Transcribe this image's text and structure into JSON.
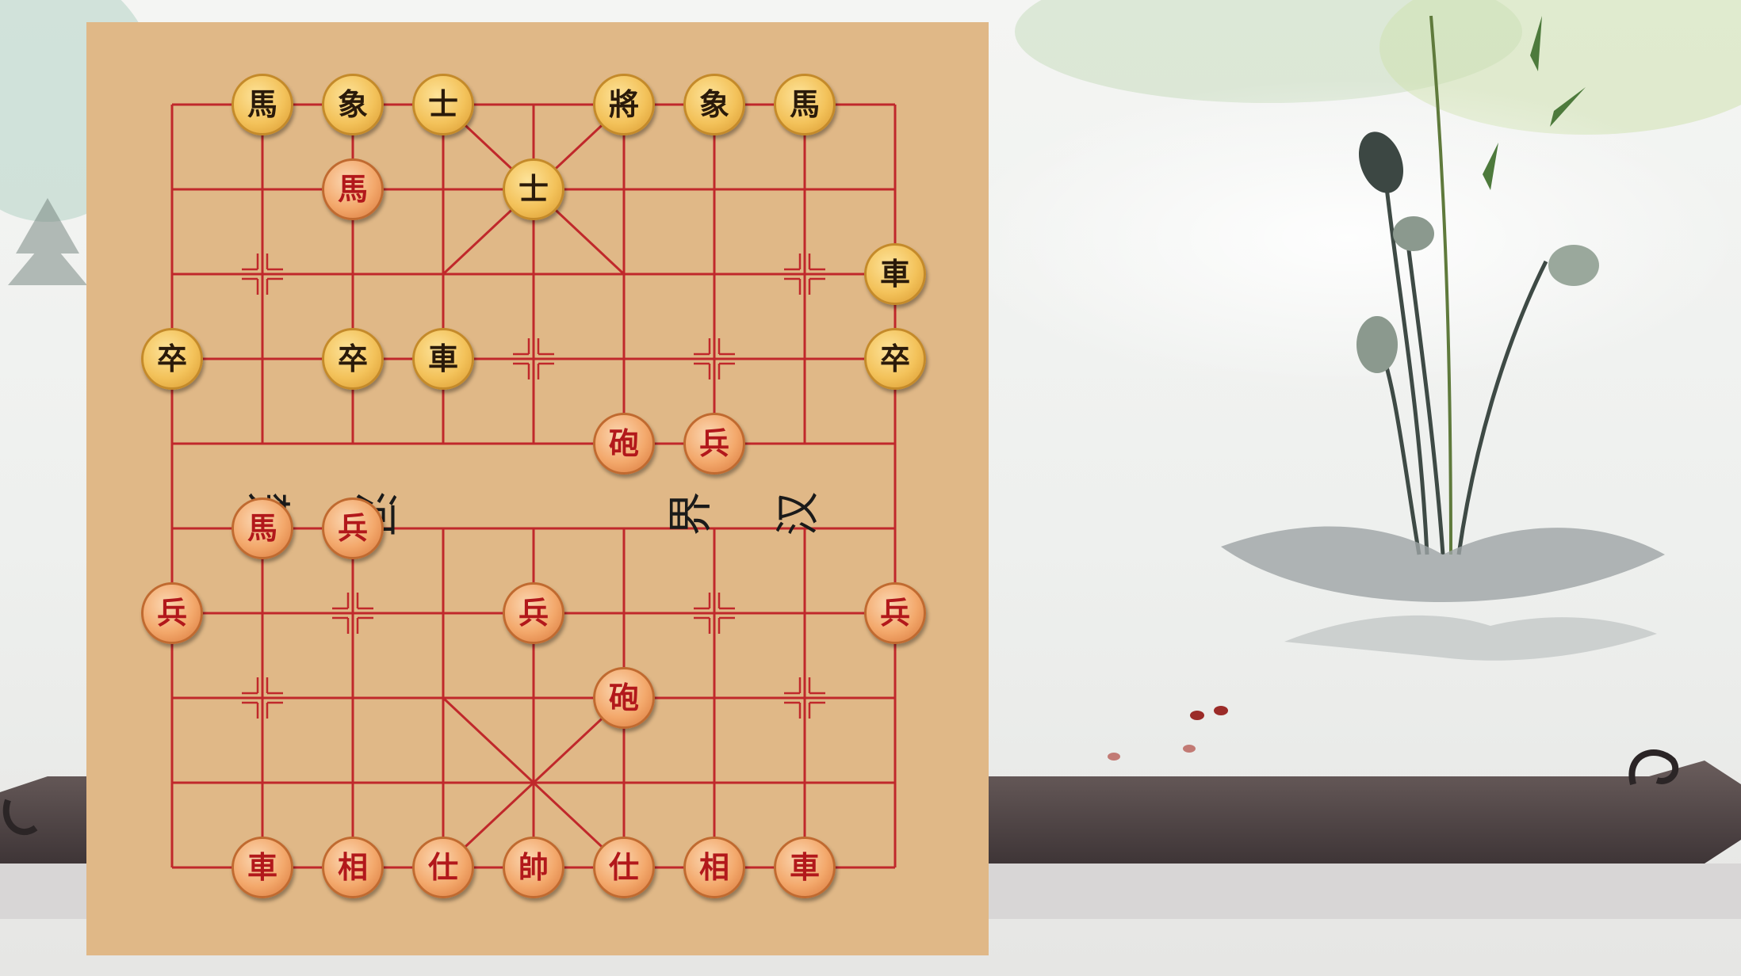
{
  "board": {
    "river_left": [
      "楚",
      "河"
    ],
    "river_right": [
      "界",
      "汉"
    ]
  },
  "pieces": [
    {
      "char": "馬",
      "color": "black",
      "col": 1,
      "row": 0
    },
    {
      "char": "象",
      "color": "black",
      "col": 2,
      "row": 0
    },
    {
      "char": "士",
      "color": "black",
      "col": 3,
      "row": 0
    },
    {
      "char": "將",
      "color": "black",
      "col": 5,
      "row": 0
    },
    {
      "char": "象",
      "color": "black",
      "col": 6,
      "row": 0
    },
    {
      "char": "馬",
      "color": "black",
      "col": 7,
      "row": 0
    },
    {
      "char": "馬",
      "color": "red",
      "col": 2,
      "row": 1
    },
    {
      "char": "士",
      "color": "black",
      "col": 4,
      "row": 1
    },
    {
      "char": "車",
      "color": "black",
      "col": 8,
      "row": 2
    },
    {
      "char": "卒",
      "color": "black",
      "col": 0,
      "row": 3
    },
    {
      "char": "卒",
      "color": "black",
      "col": 2,
      "row": 3
    },
    {
      "char": "車",
      "color": "black",
      "col": 3,
      "row": 3
    },
    {
      "char": "卒",
      "color": "black",
      "col": 8,
      "row": 3
    },
    {
      "char": "砲",
      "color": "red",
      "col": 5,
      "row": 4
    },
    {
      "char": "兵",
      "color": "red",
      "col": 6,
      "row": 4
    },
    {
      "char": "馬",
      "color": "red",
      "col": 1,
      "row": 5
    },
    {
      "char": "兵",
      "color": "red",
      "col": 2,
      "row": 5
    },
    {
      "char": "兵",
      "color": "red",
      "col": 0,
      "row": 6
    },
    {
      "char": "兵",
      "color": "red",
      "col": 4,
      "row": 6
    },
    {
      "char": "兵",
      "color": "red",
      "col": 8,
      "row": 6
    },
    {
      "char": "砲",
      "color": "red",
      "col": 5,
      "row": 7
    },
    {
      "char": "車",
      "color": "red",
      "col": 1,
      "row": 9
    },
    {
      "char": "相",
      "color": "red",
      "col": 2,
      "row": 9
    },
    {
      "char": "仕",
      "color": "red",
      "col": 3,
      "row": 9
    },
    {
      "char": "帥",
      "color": "red",
      "col": 4,
      "row": 9
    },
    {
      "char": "仕",
      "color": "red",
      "col": 5,
      "row": 9
    },
    {
      "char": "相",
      "color": "red",
      "col": 6,
      "row": 9
    },
    {
      "char": "車",
      "color": "red",
      "col": 7,
      "row": 9
    }
  ]
}
